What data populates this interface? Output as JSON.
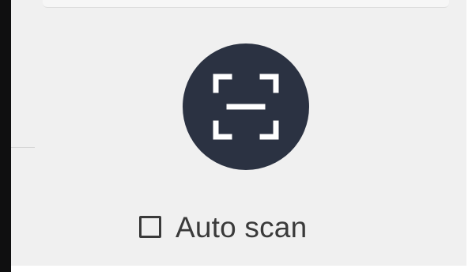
{
  "scan_button": {
    "icon": "scan-frame-icon",
    "background_color": "#2b3242",
    "icon_color": "#ffffff"
  },
  "auto_scan": {
    "label": "Auto scan",
    "checked": false
  },
  "colors": {
    "panel_background": "#f0f0f0",
    "text": "#3a3a3a",
    "left_edge": "#0f0f10"
  }
}
